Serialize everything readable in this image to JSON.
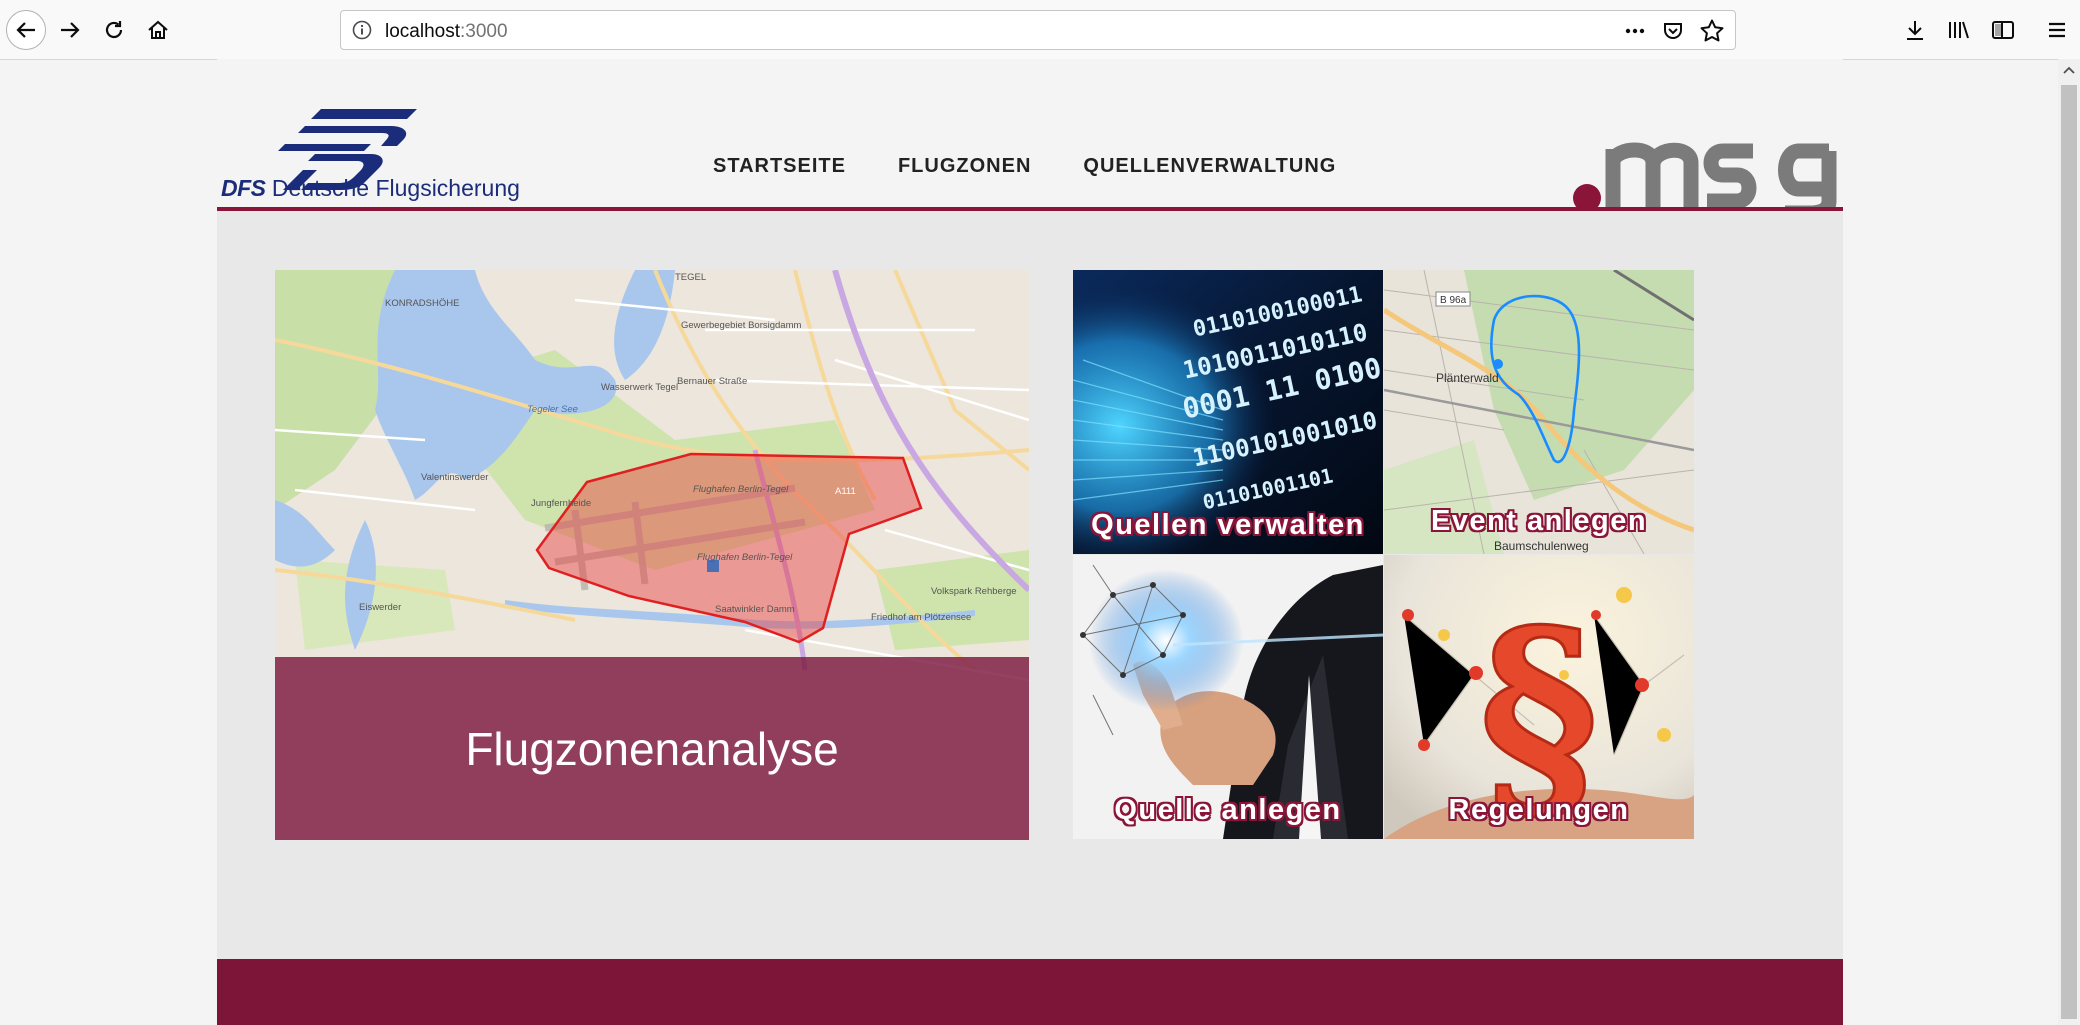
{
  "browser": {
    "url_host": "localhost",
    "url_port": ":3000"
  },
  "header": {
    "logo_text_bold": "DFS",
    "logo_text": " Deutsche Flugsicherung",
    "nav": [
      "STARTSEITE",
      "FLUGZONEN",
      "QUELLENVERWALTUNG"
    ],
    "brand_logo": ".msg"
  },
  "map_card": {
    "title": "Flugzonenanalyse",
    "map_labels": {
      "tegeler_see": "Tegeler See",
      "airport": "Flughafen Berlin-Tegel",
      "terminal": "Flughafen Berlin-Tegel",
      "valentinswerder": "Valentinswerder",
      "jungfernheide": "Jungfernheide",
      "eiswerder": "Eiswerder",
      "konradshoehe": "KONRADSHÖHE",
      "tegel": "TEGEL",
      "borsigdamm": "Gewerbegebiet Borsigdamm",
      "wasserwerk": "Wasserwerk Tegel",
      "volkspark": "Volkspark Rehberge",
      "friedhof": "Friedhof am Plötzensee",
      "saatwinkler": "Saatwinkler Damm",
      "bernauer": "Bernauer Straße",
      "a111": "A111"
    }
  },
  "tiles": [
    {
      "label": "Quellen verwalten"
    },
    {
      "label": "Event anlegen",
      "sublabel": "Baumschulenweg",
      "map_text": "Plänterwald",
      "road": "B 96a"
    },
    {
      "label": "Quelle anlegen"
    },
    {
      "label": "Regelungen"
    }
  ],
  "colors": {
    "brand": "#8a1538",
    "footer": "#7d1538",
    "dfs_blue": "#1b2d7a",
    "msg_gray": "#7b7b7b"
  },
  "icons": [
    "back-icon",
    "forward-icon",
    "reload-icon",
    "home-icon",
    "info-icon",
    "more-icon",
    "pocket-icon",
    "star-icon",
    "download-icon",
    "library-icon",
    "sidebar-icon",
    "menu-icon"
  ]
}
